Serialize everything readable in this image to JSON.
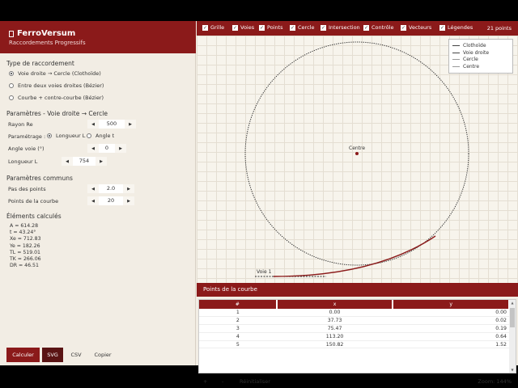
{
  "brand": {
    "title": "FerroVersum",
    "subtitle": "Raccordements Progressifs"
  },
  "sidebar": {
    "type_title": "Type de raccordement",
    "types": [
      {
        "label": "Voie droite → Cercle (Clothoïde)",
        "selected": true
      },
      {
        "label": "Entre deux voies droites (Bézier)",
        "selected": false
      },
      {
        "label": "Courbe + contre-courbe (Bézier)",
        "selected": false
      }
    ],
    "params_title": "Paramètres - Voie droite → Cercle",
    "rayon_label": "Rayon Re",
    "rayon_value": "500",
    "param_label": "Paramétrage :",
    "param_options": [
      {
        "label": "Longueur L",
        "selected": true
      },
      {
        "label": "Angle t",
        "selected": false
      }
    ],
    "angle_label": "Angle voie (°)",
    "angle_value": "0",
    "longueur_label": "Longueur L",
    "longueur_value": "754",
    "common_title": "Paramètres communs",
    "pas_label": "Pas des points",
    "pas_value": "2.0",
    "points_label": "Points de la courbe",
    "points_value": "20",
    "results_title": "Éléments calculés",
    "results": [
      "A = 614.28",
      "t = 43.24°",
      "Xe = 712.83",
      "Ye = 182.26",
      "TL = 519.01",
      "TK = 266.06",
      "DR = 46.51"
    ],
    "calc_label": "Calculer",
    "svg_label": "SVG",
    "csv_label": "CSV",
    "copy_label": "Copier"
  },
  "toolbar": {
    "items": [
      {
        "label": "Grille",
        "checked": true
      },
      {
        "label": "Voies",
        "checked": true
      },
      {
        "label": "Points",
        "checked": true
      },
      {
        "label": "Cercle",
        "checked": true
      },
      {
        "label": "Intersection",
        "checked": true
      },
      {
        "label": "Contrôle",
        "checked": true
      },
      {
        "label": "Vecteurs",
        "checked": true
      },
      {
        "label": "Légendes",
        "checked": true
      }
    ],
    "count": "21 points"
  },
  "canvas": {
    "legend": [
      "Clothoïde",
      "Voie droite",
      "Cercle",
      "Centre"
    ],
    "centre_label": "Centre",
    "track_label": "Voie 1",
    "colors": {
      "clothoid": "#8b1a1a",
      "circle": "#333333"
    }
  },
  "points": {
    "title": "Points de la courbe",
    "columns": [
      "#",
      "x",
      "y"
    ],
    "rows": [
      [
        "1",
        "0.00",
        "0.00"
      ],
      [
        "2",
        "37.73",
        "0.02"
      ],
      [
        "3",
        "75.47",
        "0.19"
      ],
      [
        "4",
        "113.20",
        "0.64"
      ],
      [
        "5",
        "150.82",
        "1.52"
      ]
    ]
  },
  "bottombar": {
    "plus": "+",
    "minus": "-",
    "reset": "Réinitialiser",
    "zoom": "Zoom: 144%"
  },
  "colors": {
    "accent": "#8b1a1a",
    "background": "#f2ede4"
  }
}
